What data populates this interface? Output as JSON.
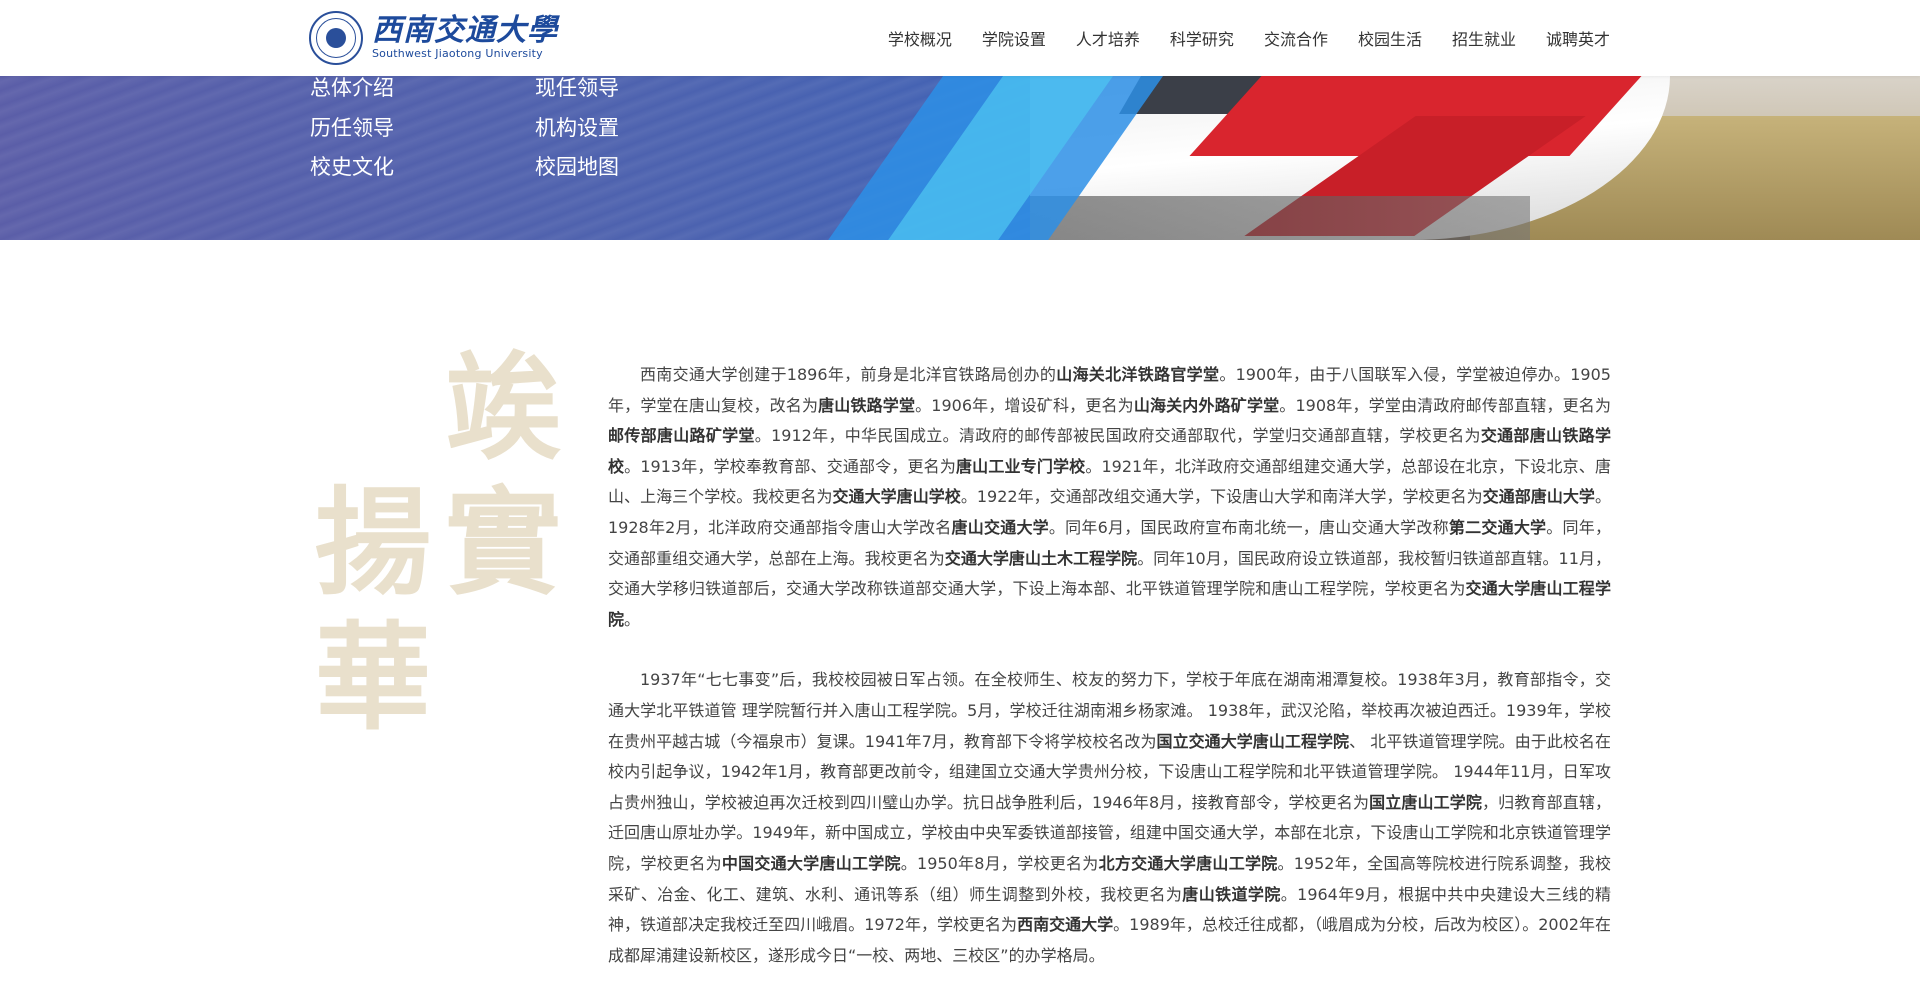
{
  "header": {
    "logo_cn": "西南交通大學",
    "logo_en": "Southwest Jiaotong University",
    "nav": [
      "学校概况",
      "学院设置",
      "人才培养",
      "科学研究",
      "交流合作",
      "校园生活",
      "招生就业",
      "诚聘英才"
    ]
  },
  "banner": {
    "sub_links": [
      "总体介绍",
      "现任领导",
      "历任领导",
      "机构设置",
      "校史文化",
      "校园地图"
    ]
  },
  "calligraphy": [
    "竢",
    "實",
    "揚",
    "華"
  ],
  "paragraphs": [
    [
      {
        "t": "西南交通大学创建于1896年，前身是北洋官铁路局创办的"
      },
      {
        "t": "山海关北洋铁路官学堂",
        "b": true
      },
      {
        "t": "。1900年，由于八国联军入侵，学堂被迫停办。1905年，学堂在唐山复校，改名为"
      },
      {
        "t": "唐山铁路学堂",
        "b": true
      },
      {
        "t": "。1906年，增设矿科，更名为"
      },
      {
        "t": "山海关内外路矿学堂",
        "b": true
      },
      {
        "t": "。1908年，学堂由清政府邮传部直辖，更名为"
      },
      {
        "t": "邮传部唐山路矿学堂",
        "b": true
      },
      {
        "t": "。1912年，中华民国成立。清政府的邮传部被民国政府交通部取代，学堂归交通部直辖，学校更名为"
      },
      {
        "t": "交通部唐山铁路学校",
        "b": true
      },
      {
        "t": "。1913年，学校奉教育部、交通部令，更名为"
      },
      {
        "t": "唐山工业专门学校",
        "b": true
      },
      {
        "t": "。1921年，北洋政府交通部组建交通大学，总部设在北京，下设北京、唐山、上海三个学校。我校更名为"
      },
      {
        "t": "交通大学唐山学校",
        "b": true
      },
      {
        "t": "。1922年，交通部改组交通大学，下设唐山大学和南洋大学，学校更名为"
      },
      {
        "t": "交通部唐山大学",
        "b": true
      },
      {
        "t": "。1928年2月，北洋政府交通部指令唐山大学改名"
      },
      {
        "t": "唐山交通大学",
        "b": true
      },
      {
        "t": "。同年6月，国民政府宣布南北统一，唐山交通大学改称"
      },
      {
        "t": "第二交通大学",
        "b": true
      },
      {
        "t": "。同年，交通部重组交通大学，总部在上海。我校更名为"
      },
      {
        "t": "交通大学唐山土木工程学院",
        "b": true
      },
      {
        "t": "。同年10月，国民政府设立铁道部，我校暂归铁道部直辖。11月，交通大学移归铁道部后，交通大学改称铁道部交通大学，下设上海本部、北平铁道管理学院和唐山工程学院，学校更名为"
      },
      {
        "t": "交通大学唐山工程学院",
        "b": true
      },
      {
        "t": "。"
      }
    ],
    [
      {
        "t": "1937年“七七事变”后，我校校园被日军占领。在全校师生、校友的努力下，学校于年底在湖南湘潭复校。1938年3月，教育部指令，交通大学北平铁道管 理学院暂行并入唐山工程学院。5月，学校迁往湖南湘乡杨家滩。 1938年，武汉沦陷，举校再次被迫西迁。1939年，学校在贵州平越古城（今福泉市）复课。1941年7月，教育部下令将学校校名改为"
      },
      {
        "t": "国立交通大学唐山工程学院",
        "b": true
      },
      {
        "t": "、 北平铁道管理学院。由于此校名在校内引起争议，1942年1月，教育部更改前令，组建国立交通大学贵州分校，下设唐山工程学院和北平铁道管理学院。 1944年11月，日军攻占贵州独山，学校被迫再次迁校到四川璧山办学。抗日战争胜利后，1946年8月，接教育部令，学校更名为"
      },
      {
        "t": "国立唐山工学院",
        "b": true
      },
      {
        "t": "，归教育部直辖，迁回唐山原址办学。1949年，新中国成立，学校由中央军委铁道部接管，组建中国交通大学，本部在北京，下设唐山工学院和北京铁道管理学院，学校更名为"
      },
      {
        "t": "中国交通大学唐山工学院",
        "b": true
      },
      {
        "t": "。1950年8月，学校更名为"
      },
      {
        "t": "北方交通大学唐山工学院",
        "b": true
      },
      {
        "t": "。1952年，全国高等院校进行院系调整，我校采矿、冶金、化工、建筑、水利、通讯等系（组）师生调整到外校，我校更名为"
      },
      {
        "t": "唐山铁道学院",
        "b": true
      },
      {
        "t": "。1964年9月，根据中共中央建设大三线的精神，铁道部决定我校迁至四川峨眉。1972年，学校更名为"
      },
      {
        "t": "西南交通大学",
        "b": true
      },
      {
        "t": "。1989年，总校迁往成都，（峨眉成为分校，后改为校区）。2002年在成都犀浦建设新校区，遂形成今日“一校、两地、三校区”的办学格局。"
      }
    ]
  ]
}
